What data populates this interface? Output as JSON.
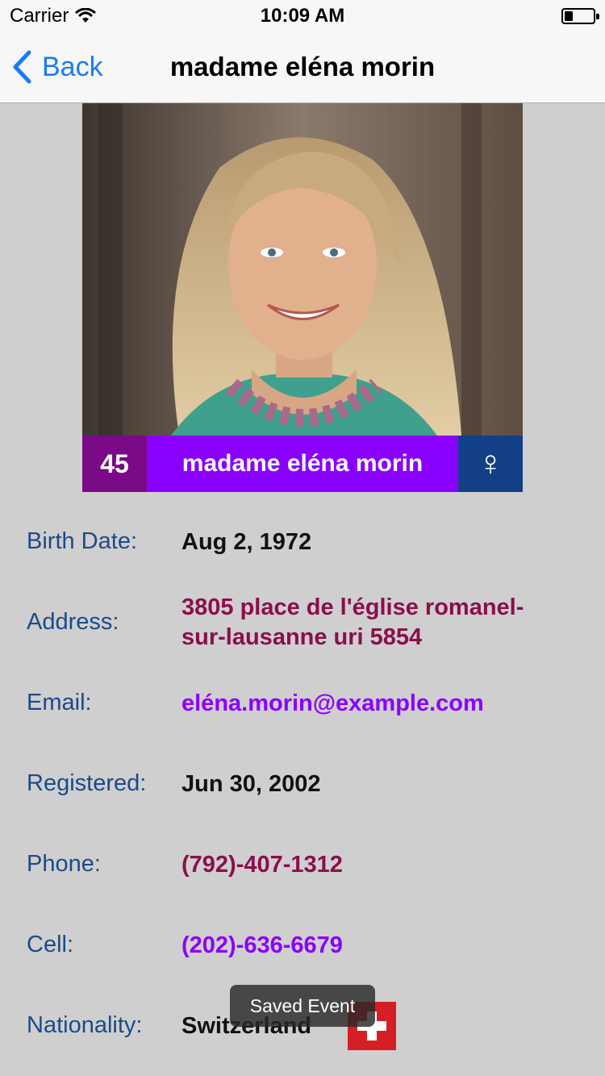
{
  "status_bar": {
    "carrier": "Carrier",
    "time": "10:09 AM",
    "battery_level": 0.3
  },
  "nav": {
    "back_label": "Back",
    "title": "madame eléna morin"
  },
  "profile": {
    "age": "45",
    "name": "madame eléna morin",
    "gender_symbol": "♀"
  },
  "details": {
    "birth_date_label": "Birth Date:",
    "birth_date_value": "Aug 2, 1972",
    "address_label": "Address:",
    "address_value": "3805 place de l'église romanel-sur-lausanne uri 5854",
    "email_label": "Email:",
    "email_value": "eléna.morin@example.com",
    "registered_label": "Registered:",
    "registered_value": "Jun 30, 2002",
    "phone_label": "Phone:",
    "phone_value": "(792)-407-1312",
    "cell_label": "Cell:",
    "cell_value": "(202)-636-6679",
    "nationality_label": "Nationality:",
    "nationality_value": "Switzerland"
  },
  "toast": {
    "message": "Saved Event"
  },
  "colors": {
    "background": "#cfcfcf",
    "age_badge": "#7a0a86",
    "name_banner": "#8a00ff",
    "gender_badge": "#123f86",
    "label_text": "#1c4a8a",
    "link_maroon": "#8b0f4b",
    "link_purple": "#8a00ff",
    "ios_blue": "#1a7cf5",
    "swiss_red": "#d61f24"
  },
  "icons": {
    "back": "chevron-left-icon",
    "wifi": "wifi-icon",
    "battery": "battery-icon",
    "gender": "female-icon",
    "flag": "swiss-flag-icon"
  }
}
